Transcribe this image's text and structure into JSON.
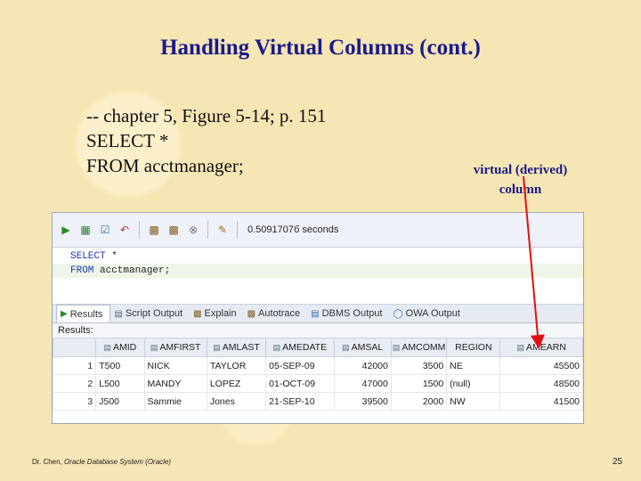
{
  "slide": {
    "title": "Handling Virtual Columns (cont.)",
    "code_lines": [
      "-- chapter 5, Figure 5-14; p. 151",
      "SELECT *",
      "FROM acctmanager;"
    ],
    "callout_line1": "virtual (derived)",
    "callout_line2": "column",
    "footer_author": "Dr. Chen, ",
    "footer_course": "Oracle Database System (Oracle)",
    "page_number": "25"
  },
  "toolbar": {
    "icons": [
      "run-icon",
      "run-script-icon",
      "commit-icon",
      "rollback-icon",
      "cancel-icon",
      "clear-icon"
    ],
    "timing": "0.5091707б seconds"
  },
  "editor": {
    "line1_kw": "SELECT",
    "line1_rest": " *",
    "line2_kw": "FROM",
    "line2_rest": " acctmanager;"
  },
  "tabs": [
    "Results",
    "Script Output",
    "Explain",
    "Autotrace",
    "DBMS Output",
    "OWA Output"
  ],
  "results_label": "Results:",
  "table": {
    "columns": [
      "AMID",
      "AMFIRST",
      "AMLAST",
      "AMEDATE",
      "AMSAL",
      "AMCOMM",
      "REGION",
      "AMEARN"
    ],
    "rows": [
      {
        "rn": "1",
        "cells": [
          "T500",
          "NICK",
          "TAYLOR",
          "05-SEP-09",
          "42000",
          "3500",
          "NE",
          "45500"
        ]
      },
      {
        "rn": "2",
        "cells": [
          "L500",
          "MANDY",
          "LOPEZ",
          "01-OCT-09",
          "47000",
          "1500",
          "(null)",
          "48500"
        ]
      },
      {
        "rn": "3",
        "cells": [
          "J500",
          "Sammie",
          "Jones",
          "21-SEP-10",
          "39500",
          "2000",
          "NW",
          "41500"
        ]
      }
    ]
  },
  "colors": {
    "title": "#1a1a8c",
    "arrow": "#e01010",
    "background": "#f6e6b4"
  }
}
